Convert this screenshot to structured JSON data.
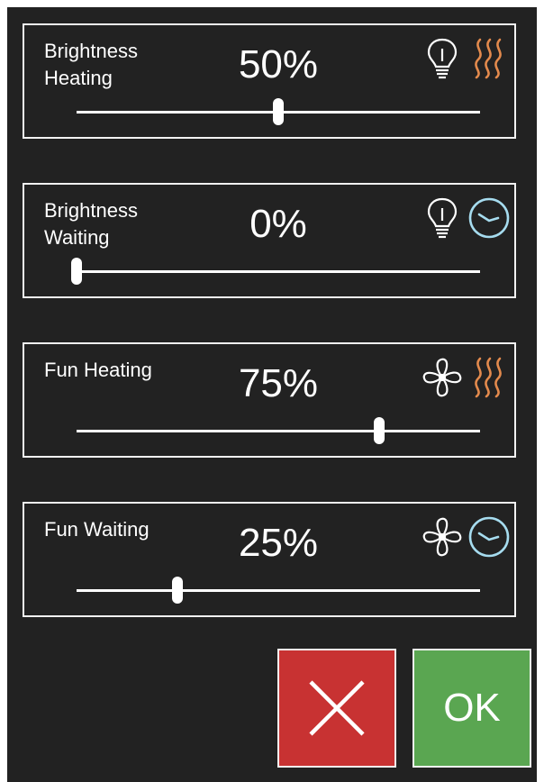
{
  "colors": {
    "background": "#222222",
    "border": "#f2f2f2",
    "heating_accent": "#e38a4d",
    "waiting_accent": "#a6dcef",
    "cancel_button": "#c83232",
    "ok_button": "#5aa651"
  },
  "panels": [
    {
      "label": "Brightness Heating",
      "value": "50%",
      "level": 0.5,
      "primary_icon": "lightbulb-icon",
      "secondary_icon": "heat-waves-icon"
    },
    {
      "label": "Brightness Waiting",
      "value": "0%",
      "level": 0.0,
      "primary_icon": "lightbulb-icon",
      "secondary_icon": "clock-icon"
    },
    {
      "label": "Fun Heating",
      "value": "75%",
      "level": 0.75,
      "primary_icon": "fan-icon",
      "secondary_icon": "heat-waves-icon"
    },
    {
      "label": "Fun Waiting",
      "value": "25%",
      "level": 0.25,
      "primary_icon": "fan-icon",
      "secondary_icon": "clock-icon"
    }
  ],
  "buttons": {
    "cancel_icon": "close-icon",
    "ok_label": "OK"
  }
}
